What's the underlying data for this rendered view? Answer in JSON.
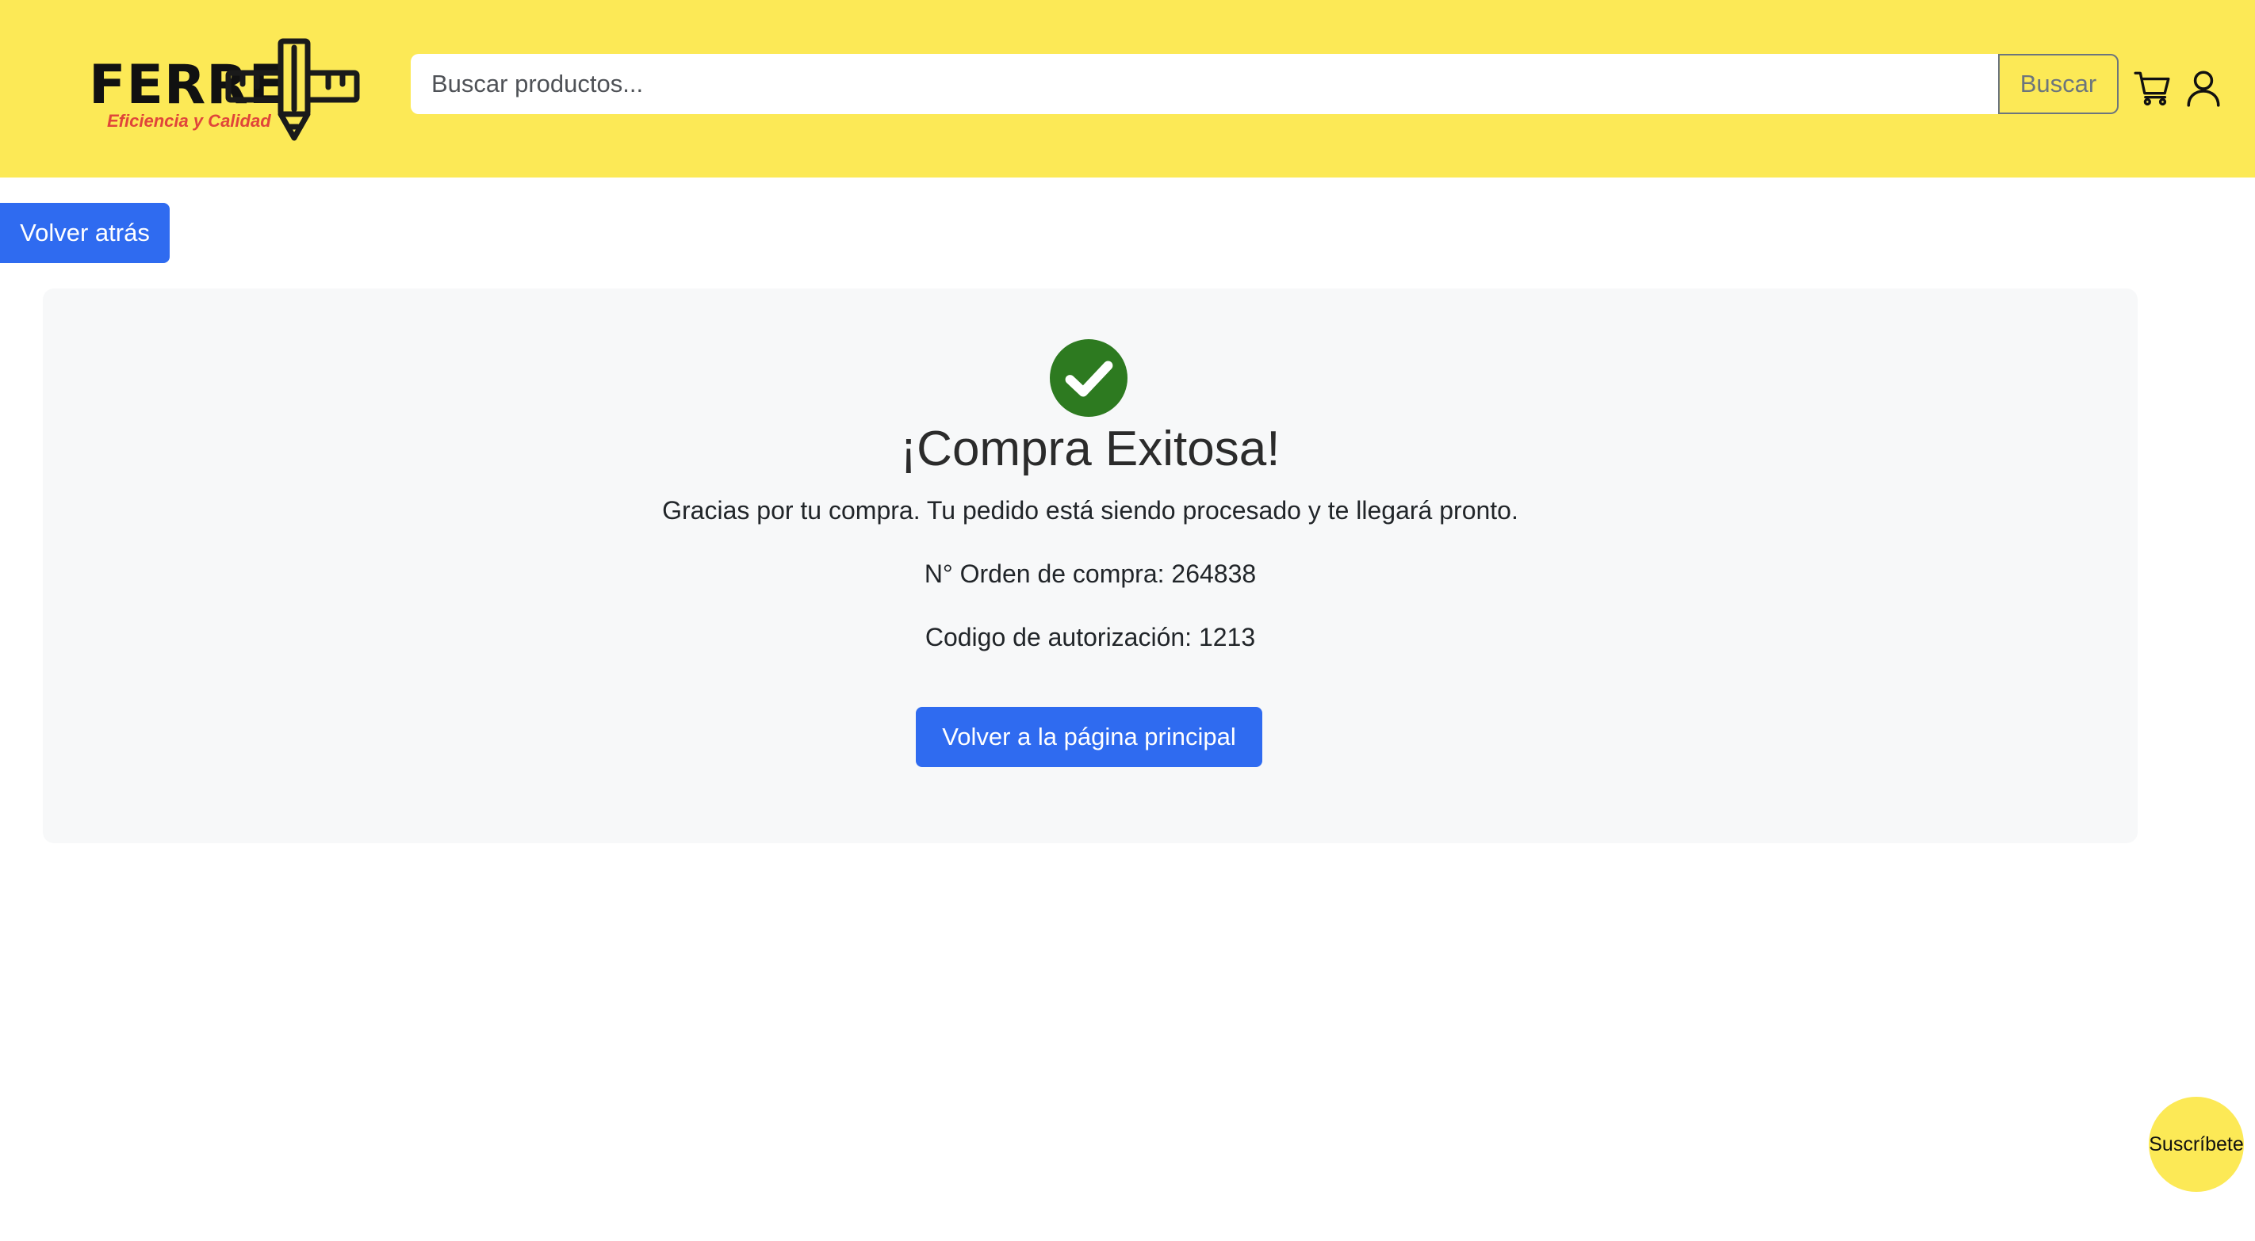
{
  "header": {
    "logo_text": "FERRE",
    "logo_tagline": "Eficiencia y Calidad",
    "search_placeholder": "Buscar productos...",
    "search_value": "",
    "search_button_label": "Buscar",
    "cart_icon": "shopping-cart-icon",
    "user_icon": "user-icon",
    "background_color": "#fce956"
  },
  "back_button_label": "Volver atrás",
  "success": {
    "icon": "check-circle-icon",
    "icon_color": "#2d7a20",
    "title": "¡Compra Exitosa!",
    "message": "Gracias por tu compra. Tu pedido está siendo procesado y te llegará pronto.",
    "order_text": "N° Orden de compra: 264838",
    "auth_text": "Codigo de autorización: 1213",
    "home_button_label": "Volver a la página principal"
  },
  "subscribe_label": "Suscríbete",
  "colors": {
    "primary_button": "#2f6bf0",
    "card_background": "#f7f8f9"
  }
}
